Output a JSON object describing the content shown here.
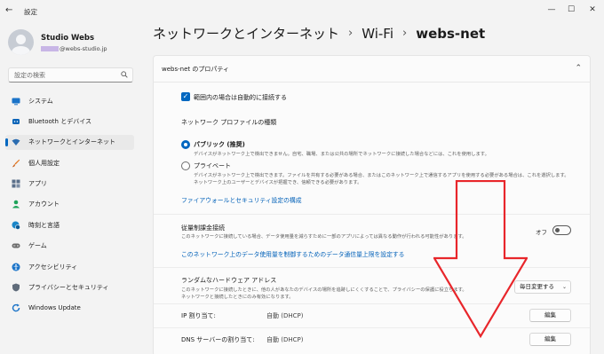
{
  "window": {
    "title": "設定",
    "back_glyph": "←",
    "controls": {
      "minimize": "—",
      "maximize": "☐",
      "close": "✕"
    }
  },
  "profile": {
    "name": "Studio Webs",
    "email": "@webs-studio.jp"
  },
  "search": {
    "placeholder": "設定の検索"
  },
  "sidebar": {
    "items": [
      {
        "label": "システム",
        "icon": "monitor-icon",
        "color": "#1a73c8"
      },
      {
        "label": "Bluetooth とデバイス",
        "icon": "bluetooth-icon",
        "color": "#0a64b8"
      },
      {
        "label": "ネットワークとインターネット",
        "icon": "wifi-icon",
        "color": "#2b6cb0",
        "active": true
      },
      {
        "label": "個人用設定",
        "icon": "brush-icon",
        "color": "#e2731b"
      },
      {
        "label": "アプリ",
        "icon": "apps-icon",
        "color": "#5b6f8a"
      },
      {
        "label": "アカウント",
        "icon": "person-icon",
        "color": "#1ea35a"
      },
      {
        "label": "時刻と言語",
        "icon": "globe-clock-icon",
        "color": "#1a86c8"
      },
      {
        "label": "ゲーム",
        "icon": "gamepad-icon",
        "color": "#6b6b6b"
      },
      {
        "label": "アクセシビリティ",
        "icon": "accessibility-icon",
        "color": "#1a73c8"
      },
      {
        "label": "プライバシーとセキュリティ",
        "icon": "shield-icon",
        "color": "#5f6b7a"
      },
      {
        "label": "Windows Update",
        "icon": "update-icon",
        "color": "#1a73c8"
      }
    ]
  },
  "breadcrumb": {
    "parts": [
      "ネットワークとインターネット",
      "Wi-Fi",
      "webs-net"
    ],
    "separator": "›"
  },
  "panel": {
    "title": "webs-net のプロパティ",
    "collapse_glyph": "⌃",
    "auto_connect": {
      "label": "範囲内の場合は自動的に接続する",
      "checked": true
    },
    "profile_type": {
      "heading": "ネットワーク プロファイルの種類",
      "public": {
        "label": "パブリック (推奨)",
        "desc": "デバイスがネットワーク上で検出できません。自宅、職場、または公共の場所でネットワークに接続した場合などには、これを使用します。",
        "selected": true
      },
      "private": {
        "label": "プライベート",
        "desc1": "デバイスがネットワーク上で検出できます。ファイルを共有する必要がある場合、またはこのネットワーク上で通信するアプリを使用する必要がある場合は、これを選択します。",
        "desc2": "ネットワーク上のユーザーとデバイスが把握でき、信頼できる必要があります。",
        "selected": false
      },
      "firewall_link": "ファイアウォールとセキュリティ設定の構成"
    },
    "metered": {
      "label": "従量制課金接続",
      "desc": "このネットワークに接続している場合、データ使用量を減らすために一部のアプリによっては異なる動作が行われる可能性があります。",
      "state": "オフ",
      "link": "このネットワーク上のデータ使用量を制御するためのデータ通信量上限を設定する"
    },
    "random_hw": {
      "label": "ランダムなハードウェア アドレス",
      "desc1": "このネットワークに接続したときに、他の人があなたのデバイスの場所を追跡しにくくすることで、プライバシーの保護に役立ちます。",
      "desc2": "ネットワークと接続したときにのみ有効になります。",
      "dropdown": "毎日変更する"
    },
    "ip_assign": {
      "label": "IP 割り当て:",
      "value": "自動 (DHCP)",
      "button": "編集"
    },
    "dns_assign": {
      "label": "DNS サーバーの割り当て:",
      "value": "自動 (DHCP)",
      "button": "編集"
    }
  },
  "annotation": {
    "arrow_color": "#e8262b",
    "direction": "down"
  }
}
